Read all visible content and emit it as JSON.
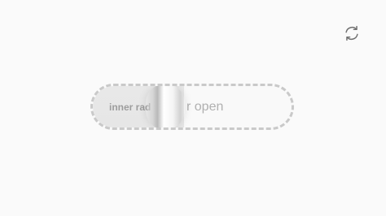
{
  "toolbar": {
    "refresh_icon": "refresh-icon"
  },
  "toggle": {
    "inner_label": "inner rad",
    "outer_label": "r open"
  }
}
